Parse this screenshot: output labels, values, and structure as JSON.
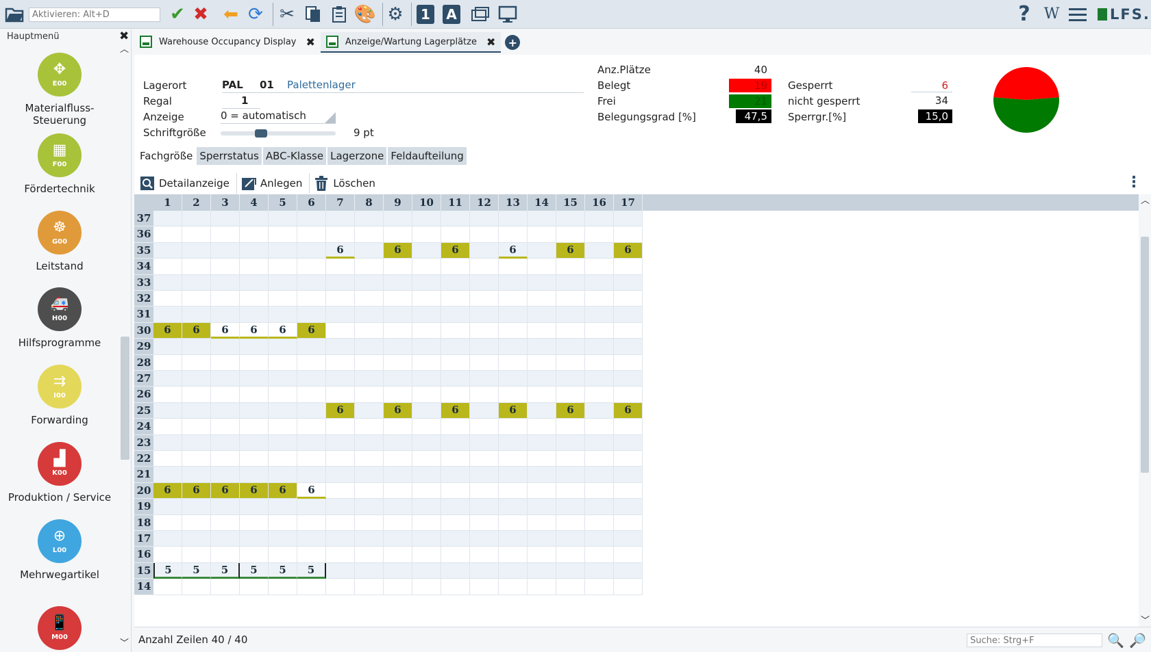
{
  "toolbar": {
    "activate_placeholder": "Aktivieren: Alt+D",
    "logo_text": "LFS."
  },
  "sidebar": {
    "title": "Hauptmenü",
    "items": [
      {
        "code": "E00",
        "label": "Materialfluss-\nSteuerung",
        "color": "#a8c23a",
        "icon": "flow-arrows-icon"
      },
      {
        "code": "F00",
        "label": "Fördertechnik",
        "color": "#a8c23a",
        "icon": "conveyor-icon"
      },
      {
        "code": "G00",
        "label": "Leitstand",
        "color": "#e09a3a",
        "icon": "control-wheel-icon"
      },
      {
        "code": "H00",
        "label": "Hilfsprogramme",
        "color": "#4e4e4e",
        "icon": "ambulance-icon"
      },
      {
        "code": "I00",
        "label": "Forwarding",
        "color": "#e4d85a",
        "icon": "forward-arrows-icon"
      },
      {
        "code": "K00",
        "label": "Produktion / Service",
        "color": "#d63a3a",
        "icon": "factory-icon"
      },
      {
        "code": "L00",
        "label": "Mehrwegartikel",
        "color": "#3fa6e0",
        "icon": "recycle-icon"
      },
      {
        "code": "M00",
        "label": "",
        "color": "#d63a3a",
        "icon": "mobile-gear-icon"
      }
    ]
  },
  "tabs": [
    {
      "label": "Warehouse Occupancy Display",
      "active": false
    },
    {
      "label": "Anzeige/Wartung Lagerplätze",
      "active": true
    }
  ],
  "form": {
    "lagerort_label": "Lagerort",
    "lagerort_code": "PAL",
    "lagerort_num": "01",
    "lagerort_name": "Palettenlager",
    "regal_label": "Regal",
    "regal_value": "1",
    "anzeige_label": "Anzeige",
    "anzeige_value": "0 = automatisch",
    "schrift_label": "Schriftgröße",
    "schrift_value": "9 pt",
    "schrift_level": 0.33
  },
  "stats": {
    "anz_plaetze_label": "Anz.Plätze",
    "anz_plaetze_value": "40",
    "belegt_label": "Belegt",
    "belegt_value": "19",
    "frei_label": "Frei",
    "frei_value": "21",
    "belegungsgrad_label": "Belegungsgrad [%]",
    "belegungsgrad_value": "47,5",
    "gesperrt_label": "Gesperrt",
    "gesperrt_value": "6",
    "nicht_gesperrt_label": "nicht gesperrt",
    "nicht_gesperrt_value": "34",
    "sperrgrad_label": "Sperrgr.[%]",
    "sperrgrad_value": "15,0",
    "pie": {
      "belegt": 19,
      "frei": 21,
      "belegt_color": "#ff0000",
      "frei_color": "#007a00"
    }
  },
  "subtabs": [
    "Fachgröße",
    "Sperrstatus",
    "ABC-Klasse",
    "Lagerzone",
    "Feldaufteilung"
  ],
  "actions": [
    {
      "label": "Detailanzeige",
      "icon": "magnifier-icon"
    },
    {
      "label": "Anlegen",
      "icon": "create-icon"
    },
    {
      "label": "Löschen",
      "icon": "trash-icon"
    }
  ],
  "grid": {
    "columns": [
      "1",
      "2",
      "3",
      "4",
      "5",
      "6",
      "7",
      "8",
      "9",
      "10",
      "11",
      "12",
      "13",
      "14",
      "15",
      "16",
      "17"
    ],
    "rows": [
      {
        "label": "37",
        "cells": []
      },
      {
        "label": "36",
        "cells": []
      },
      {
        "label": "35",
        "cells": [
          {
            "col": 7,
            "value": "6",
            "style": "under"
          },
          {
            "col": 9,
            "value": "6",
            "style": "full"
          },
          {
            "col": 11,
            "value": "6",
            "style": "full"
          },
          {
            "col": 13,
            "value": "6",
            "style": "under"
          },
          {
            "col": 15,
            "value": "6",
            "style": "full"
          },
          {
            "col": 17,
            "value": "6",
            "style": "full"
          }
        ]
      },
      {
        "label": "34",
        "cells": []
      },
      {
        "label": "33",
        "cells": []
      },
      {
        "label": "32",
        "cells": []
      },
      {
        "label": "31",
        "cells": []
      },
      {
        "label": "30",
        "cells": [
          {
            "col": 1,
            "value": "6",
            "style": "full"
          },
          {
            "col": 2,
            "value": "6",
            "style": "full"
          },
          {
            "col": 3,
            "value": "6",
            "style": "under"
          },
          {
            "col": 4,
            "value": "6",
            "style": "under"
          },
          {
            "col": 5,
            "value": "6",
            "style": "under"
          },
          {
            "col": 6,
            "value": "6",
            "style": "full"
          }
        ]
      },
      {
        "label": "29",
        "cells": []
      },
      {
        "label": "28",
        "cells": []
      },
      {
        "label": "27",
        "cells": []
      },
      {
        "label": "26",
        "cells": []
      },
      {
        "label": "25",
        "cells": [
          {
            "col": 7,
            "value": "6",
            "style": "full"
          },
          {
            "col": 9,
            "value": "6",
            "style": "full"
          },
          {
            "col": 11,
            "value": "6",
            "style": "full"
          },
          {
            "col": 13,
            "value": "6",
            "style": "full"
          },
          {
            "col": 15,
            "value": "6",
            "style": "full"
          },
          {
            "col": 17,
            "value": "6",
            "style": "full"
          }
        ]
      },
      {
        "label": "24",
        "cells": []
      },
      {
        "label": "23",
        "cells": []
      },
      {
        "label": "22",
        "cells": []
      },
      {
        "label": "21",
        "cells": []
      },
      {
        "label": "20",
        "cells": [
          {
            "col": 1,
            "value": "6",
            "style": "full"
          },
          {
            "col": 2,
            "value": "6",
            "style": "full"
          },
          {
            "col": 3,
            "value": "6",
            "style": "full"
          },
          {
            "col": 4,
            "value": "6",
            "style": "full"
          },
          {
            "col": 5,
            "value": "6",
            "style": "full"
          },
          {
            "col": 6,
            "value": "6",
            "style": "under"
          }
        ]
      },
      {
        "label": "19",
        "cells": []
      },
      {
        "label": "18",
        "cells": []
      },
      {
        "label": "17",
        "cells": []
      },
      {
        "label": "16",
        "cells": []
      },
      {
        "label": "15",
        "cells": [
          {
            "col": 1,
            "value": "5",
            "style": "green-under lbar"
          },
          {
            "col": 2,
            "value": "5",
            "style": "green-under"
          },
          {
            "col": 3,
            "value": "5",
            "style": "green-under rbar"
          },
          {
            "col": 4,
            "value": "5",
            "style": "green-under"
          },
          {
            "col": 5,
            "value": "5",
            "style": "green-under"
          },
          {
            "col": 6,
            "value": "5",
            "style": "green-under rbar"
          }
        ]
      },
      {
        "label": "14",
        "cells": []
      }
    ]
  },
  "status": {
    "rows_text": "Anzahl Zeilen 40 / 40",
    "search_placeholder": "Suche: Strg+F"
  }
}
